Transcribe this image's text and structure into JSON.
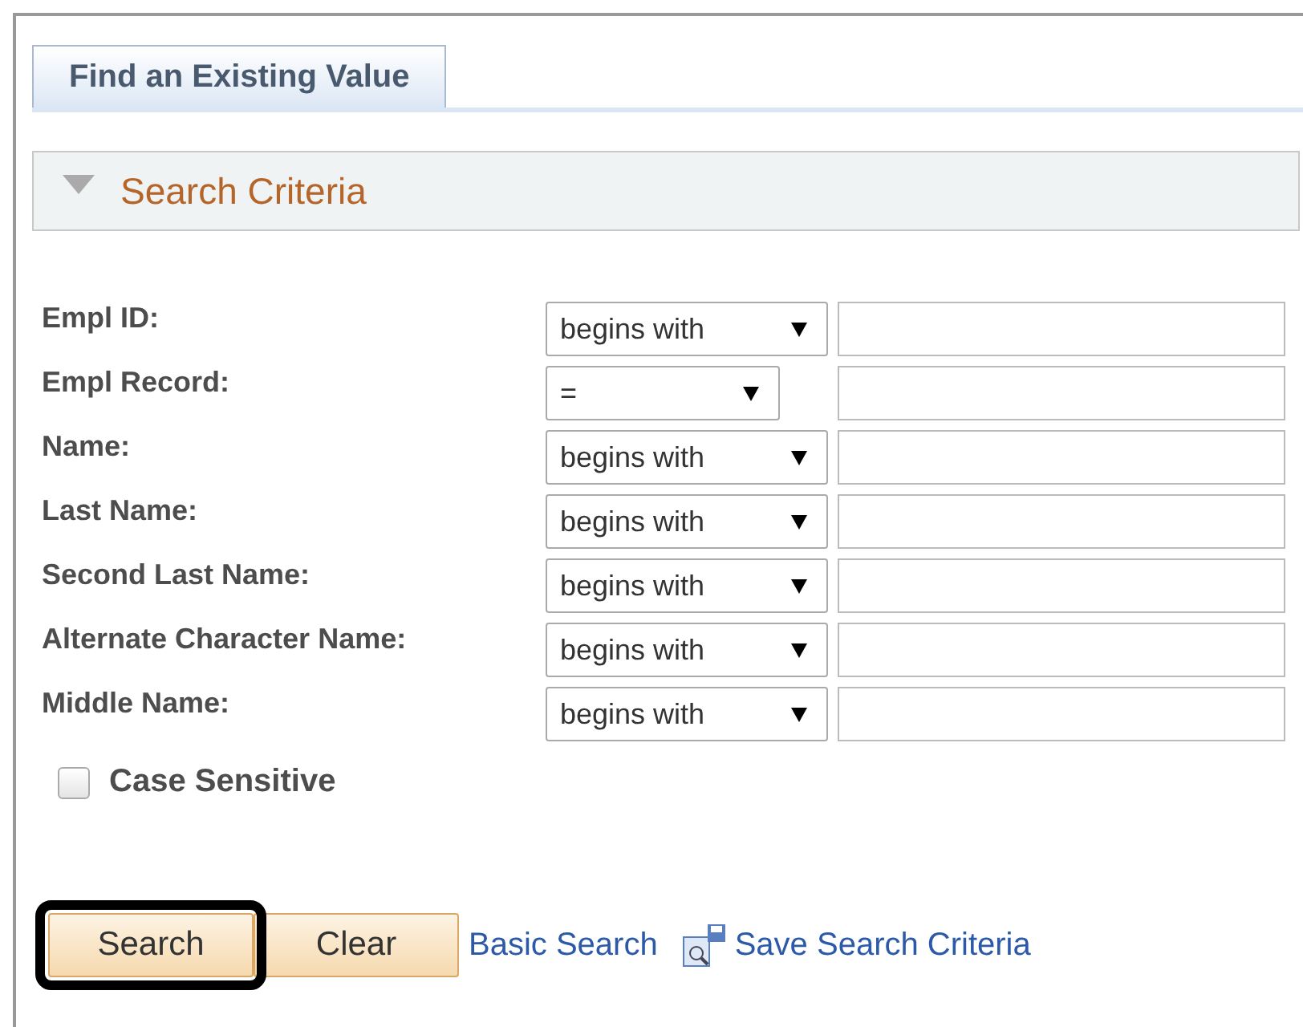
{
  "tabs": [
    {
      "label": "Find an Existing Value",
      "selected": true
    }
  ],
  "section": {
    "title": "Search Criteria",
    "expanded": true
  },
  "fields": [
    {
      "label": "Empl ID:",
      "operator": "begins with"
    },
    {
      "label": "Empl Record:",
      "operator": "="
    },
    {
      "label": "Name:",
      "operator": "begins with"
    },
    {
      "label": "Last Name:",
      "operator": "begins with"
    },
    {
      "label": "Second Last Name:",
      "operator": "begins with"
    },
    {
      "label": "Alternate Character Name:",
      "operator": "begins with"
    },
    {
      "label": "Middle Name:",
      "operator": "begins with"
    }
  ],
  "case_sensitive": {
    "label": "Case Sensitive",
    "checked": false
  },
  "buttons": [
    {
      "label": "Search",
      "highlighted": true
    },
    {
      "label": "Clear",
      "highlighted": false
    }
  ],
  "links": [
    {
      "label": "Basic Search",
      "kind": "plain"
    },
    {
      "label": "Save Search Criteria",
      "kind": "icon"
    }
  ]
}
